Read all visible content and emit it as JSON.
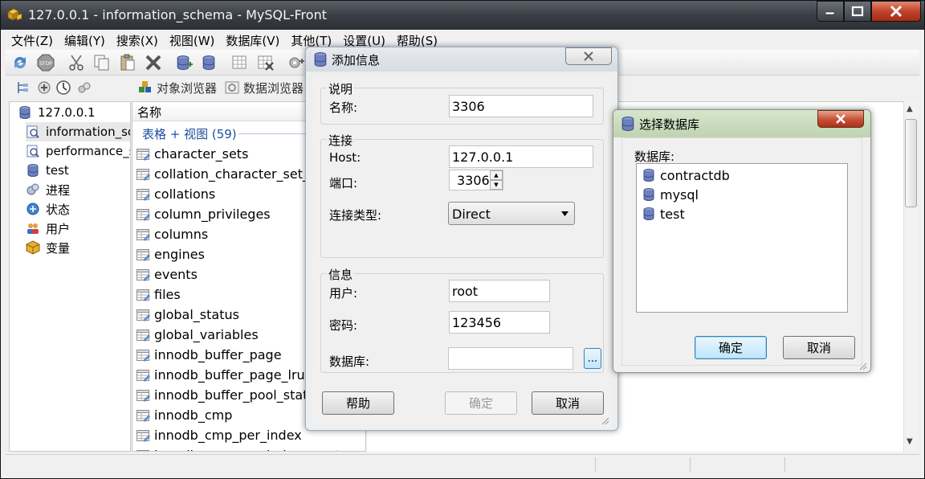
{
  "window": {
    "title": "127.0.0.1 - information_schema - MySQL-Front"
  },
  "menu": [
    "文件(Z)",
    "编辑(Y)",
    "搜索(X)",
    "视图(W)",
    "数据库(V)",
    "其他(T)",
    "设置(U)",
    "帮助(S)"
  ],
  "toolbar2": {
    "object_browser": "对象浏览器",
    "data_browser": "数据浏览器"
  },
  "tree": {
    "root": "127.0.0.1",
    "items": [
      "information_schema",
      "performance_schema",
      "test",
      "进程",
      "状态",
      "用户",
      "变量"
    ]
  },
  "list": {
    "column_header": "名称",
    "group_header": "表格 + 视图 (59)",
    "items": [
      "character_sets",
      "collation_character_set_applicability",
      "collations",
      "column_privileges",
      "columns",
      "engines",
      "events",
      "files",
      "global_status",
      "global_variables",
      "innodb_buffer_page",
      "innodb_buffer_page_lru",
      "innodb_buffer_pool_stats",
      "innodb_cmp",
      "innodb_cmp_per_index",
      "innodb_cmp_per_index_reset"
    ]
  },
  "add_dialog": {
    "title": "添加信息",
    "desc_group": "说明",
    "name_label": "名称:",
    "name_value": "3306",
    "conn_group": "连接",
    "host_label": "Host:",
    "host_value": "127.0.0.1",
    "port_label": "端口:",
    "port_value": "3306",
    "conn_type_label": "连接类型:",
    "conn_type_value": "Direct",
    "info_group": "信息",
    "user_label": "用户:",
    "user_value": "root",
    "password_label": "密码:",
    "password_value": "123456",
    "database_label": "数据库:",
    "database_value": "",
    "browse_label": "...",
    "help_button": "帮助",
    "ok_button": "确定",
    "cancel_button": "取消"
  },
  "db_dialog": {
    "title": "选择数据库",
    "list_label": "数据库:",
    "databases": [
      "contractdb",
      "mysql",
      "test"
    ],
    "ok_button": "确定",
    "cancel_button": "取消"
  },
  "colors": {
    "db_icon": "#5a6fa8",
    "link_blue": "#1e4fa0",
    "close_red": "#c64f36"
  }
}
